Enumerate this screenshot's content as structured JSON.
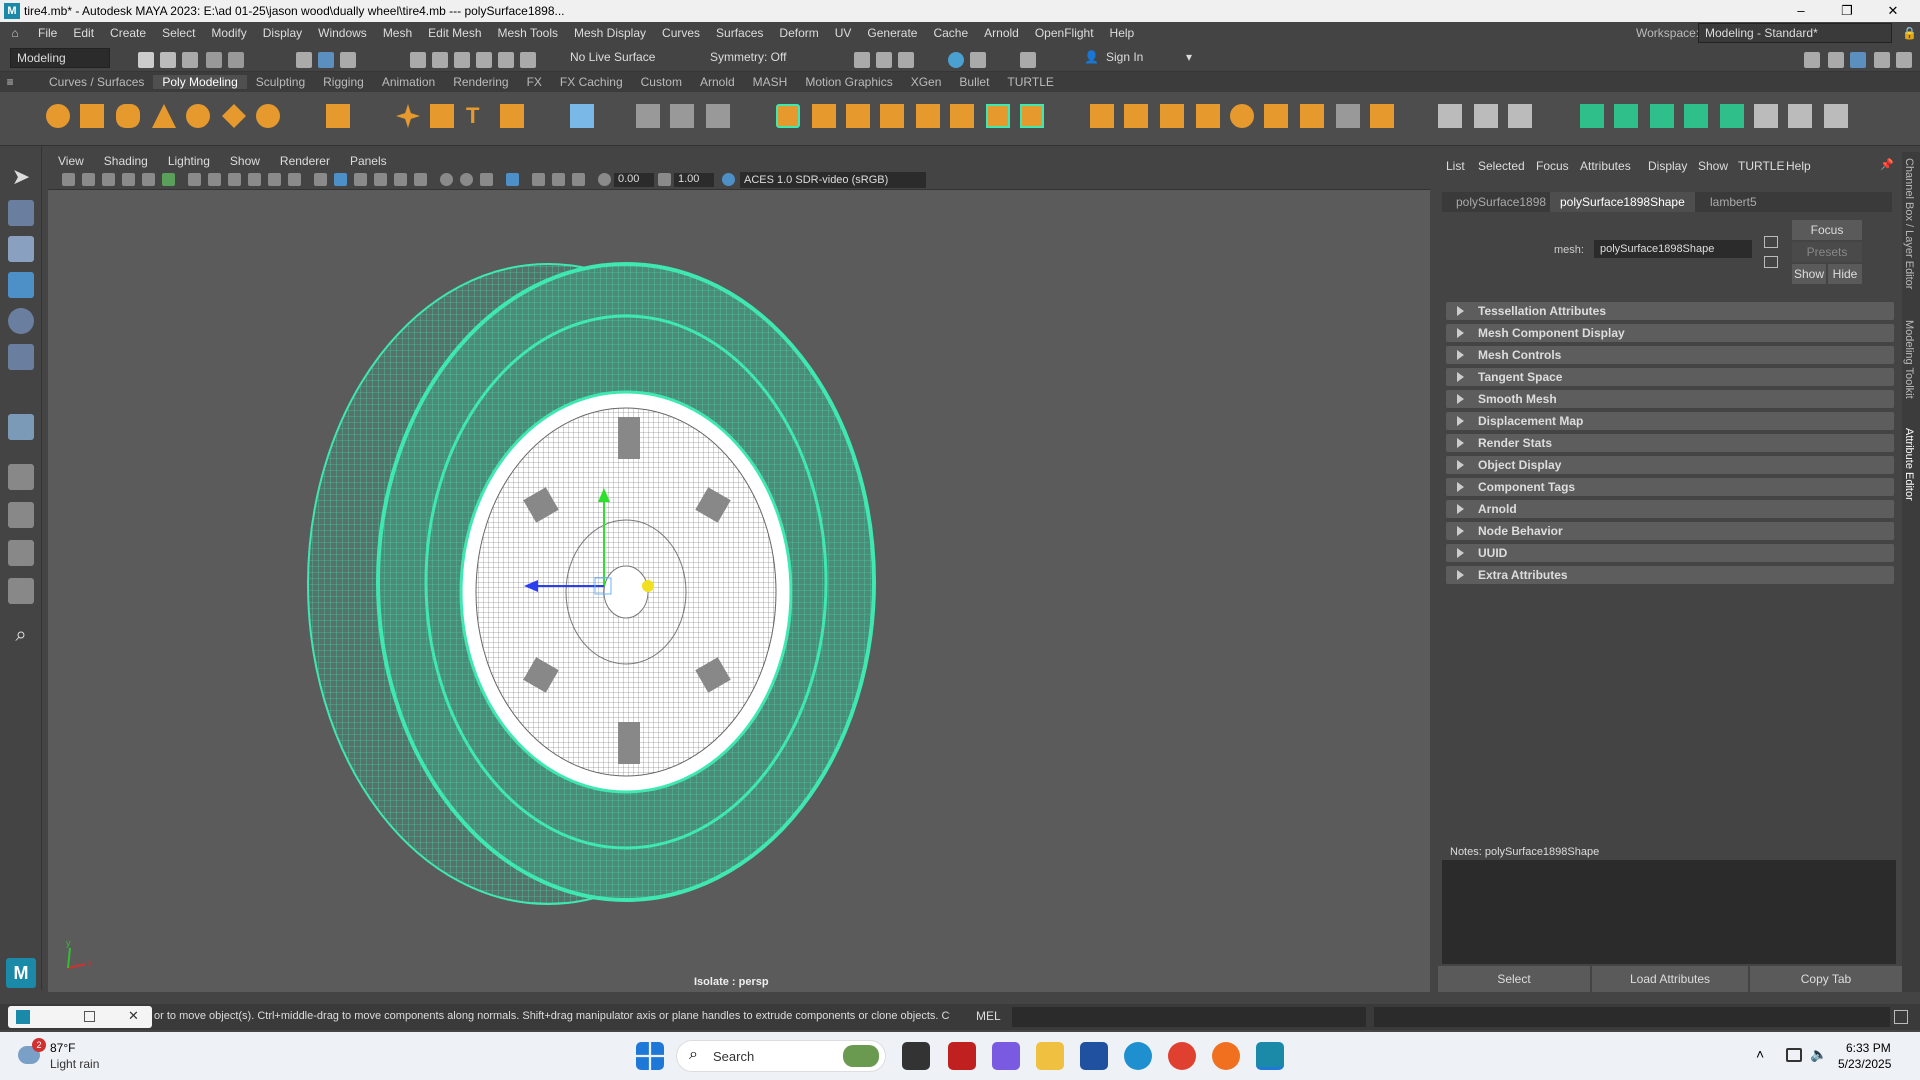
{
  "window": {
    "title": "tire4.mb* - Autodesk MAYA 2023: E:\\ad 01-25\\jason wood\\dually wheel\\tire4.mb   ---   polySurface1898...",
    "minimize": "–",
    "maximize": "❐",
    "close": "✕"
  },
  "menus": [
    "File",
    "Edit",
    "Create",
    "Select",
    "Modify",
    "Display",
    "Windows",
    "Mesh",
    "Edit Mesh",
    "Mesh Tools",
    "Mesh Display",
    "Curves",
    "Surfaces",
    "Deform",
    "UV",
    "Generate",
    "Cache",
    "Arnold",
    "OpenFlight",
    "Help"
  ],
  "workspace": {
    "label": "Workspace:",
    "value": "Modeling - Standard*"
  },
  "status_line": {
    "menuset": "Modeling",
    "live_surface": "No Live Surface",
    "symmetry": "Symmetry: Off",
    "sign_in": "Sign In"
  },
  "shelf_tabs": [
    "Curves / Surfaces",
    "Poly Modeling",
    "Sculpting",
    "Rigging",
    "Animation",
    "Rendering",
    "FX",
    "FX Caching",
    "Custom",
    "Arnold",
    "MASH",
    "Motion Graphics",
    "XGen",
    "Bullet",
    "TURTLE"
  ],
  "active_shelf_tab": "Poly Modeling",
  "viewport": {
    "menus": [
      "View",
      "Shading",
      "Lighting",
      "Show",
      "Renderer",
      "Panels"
    ],
    "exposure": "0.00",
    "gamma": "1.00",
    "colorspace": "ACES 1.0 SDR-video (sRGB)",
    "camera_label": "Isolate : persp",
    "axis_x": "x",
    "axis_y": "y"
  },
  "attribute_editor": {
    "menus": [
      "List",
      "Selected",
      "Focus",
      "Attributes",
      "Display",
      "Show",
      "TURTLE",
      "Help"
    ],
    "tabs": [
      "polySurface1898",
      "polySurface1898Shape",
      "lambert5"
    ],
    "active_tab": "polySurface1898Shape",
    "mesh_label": "mesh:",
    "mesh_value": "polySurface1898Shape",
    "focus_button": "Focus",
    "presets_button": "Presets",
    "show_button": "Show",
    "hide_button": "Hide",
    "sections": [
      "Tessellation Attributes",
      "Mesh Component Display",
      "Mesh Controls",
      "Tangent Space",
      "Smooth Mesh",
      "Displacement Map",
      "Render Stats",
      "Object Display",
      "Component Tags",
      "Arnold",
      "Node Behavior",
      "UUID",
      "Extra Attributes"
    ],
    "notes_label": "Notes:  polySurface1898Shape",
    "select_button": "Select",
    "load_button": "Load Attributes",
    "copy_button": "Copy Tab"
  },
  "side_tabs": [
    "Channel Box / Layer Editor",
    "Modeling Toolkit",
    "Attribute Editor"
  ],
  "help_line": {
    "text": "or to move object(s). Ctrl+middle-drag to move components along normals. Shift+drag manipulator axis or plane handles to extrude components or clone objects. Ctrl+Shift+drag to",
    "mel_label": "MEL"
  },
  "taskbar": {
    "weather_temp": "87°F",
    "weather_desc": "Light rain",
    "weather_badge": "2",
    "search_placeholder": "Search",
    "time": "6:33 PM",
    "date": "5/23/2025"
  },
  "colors": {
    "wireframe": "#3fe8b0",
    "viewport_bg": "#5b5b5b",
    "panel_bg": "#444444",
    "accent": "#1a8aa8"
  }
}
